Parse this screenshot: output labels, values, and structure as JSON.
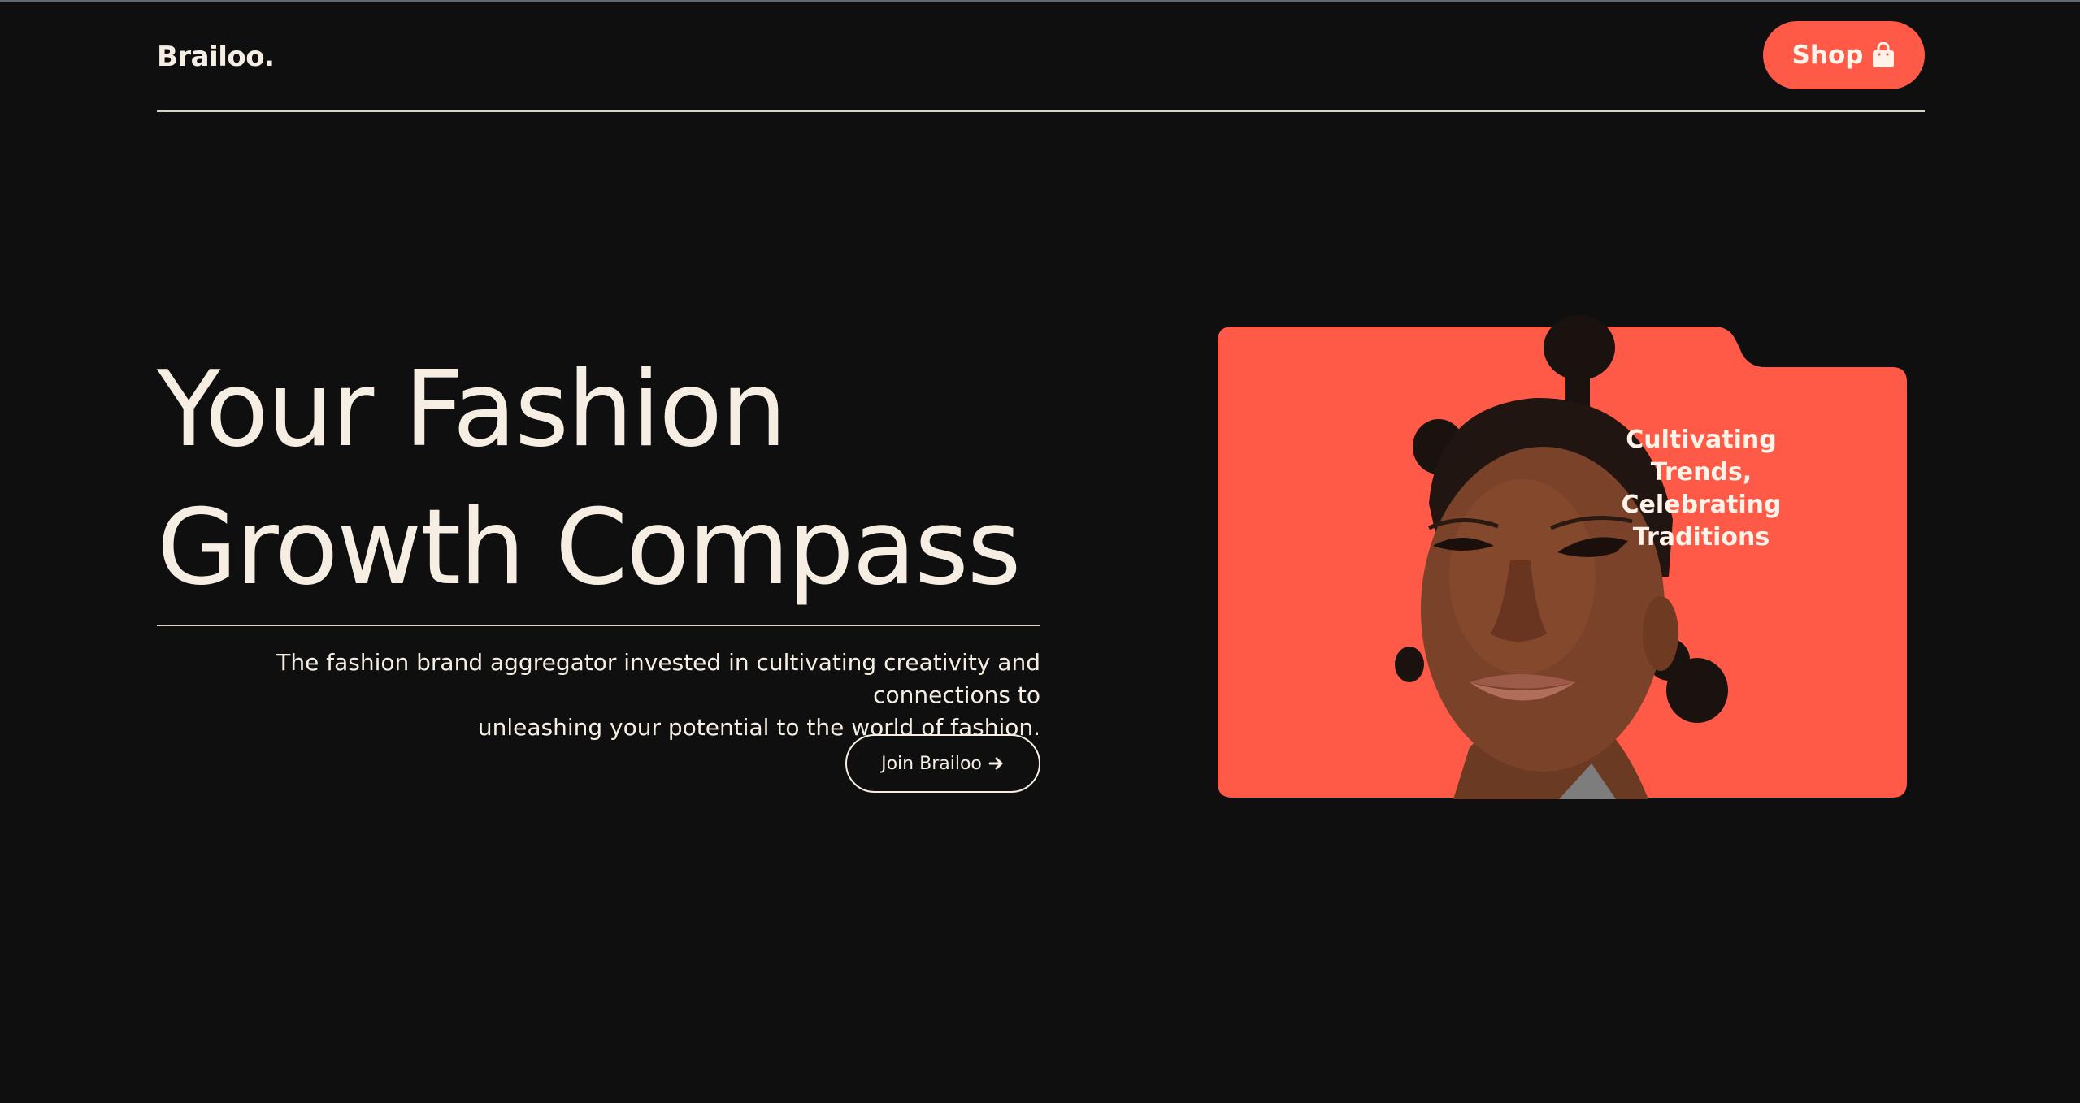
{
  "brand": {
    "name": "Brailoo."
  },
  "nav": {
    "shop_label": "Shop",
    "shop_icon": "shopping-bag-icon"
  },
  "hero": {
    "title_line1": "Your Fashion",
    "title_line2": "Growth Compass",
    "description_line1": "The fashion brand aggregator invested in cultivating creativity and connections to",
    "description_line2": "unleashing your potential to the world of fashion.",
    "cta_label": "Join Brailoo",
    "cta_icon": "arrow-right-icon"
  },
  "card": {
    "caption_line1": "Cultivating",
    "caption_line2": "Trends,",
    "caption_line3": "Celebrating",
    "caption_line4": "Traditions",
    "image": "portrait-photo"
  },
  "colors": {
    "background": "#0f0f0f",
    "accent": "#ff5a47",
    "text": "#f6eee3"
  }
}
